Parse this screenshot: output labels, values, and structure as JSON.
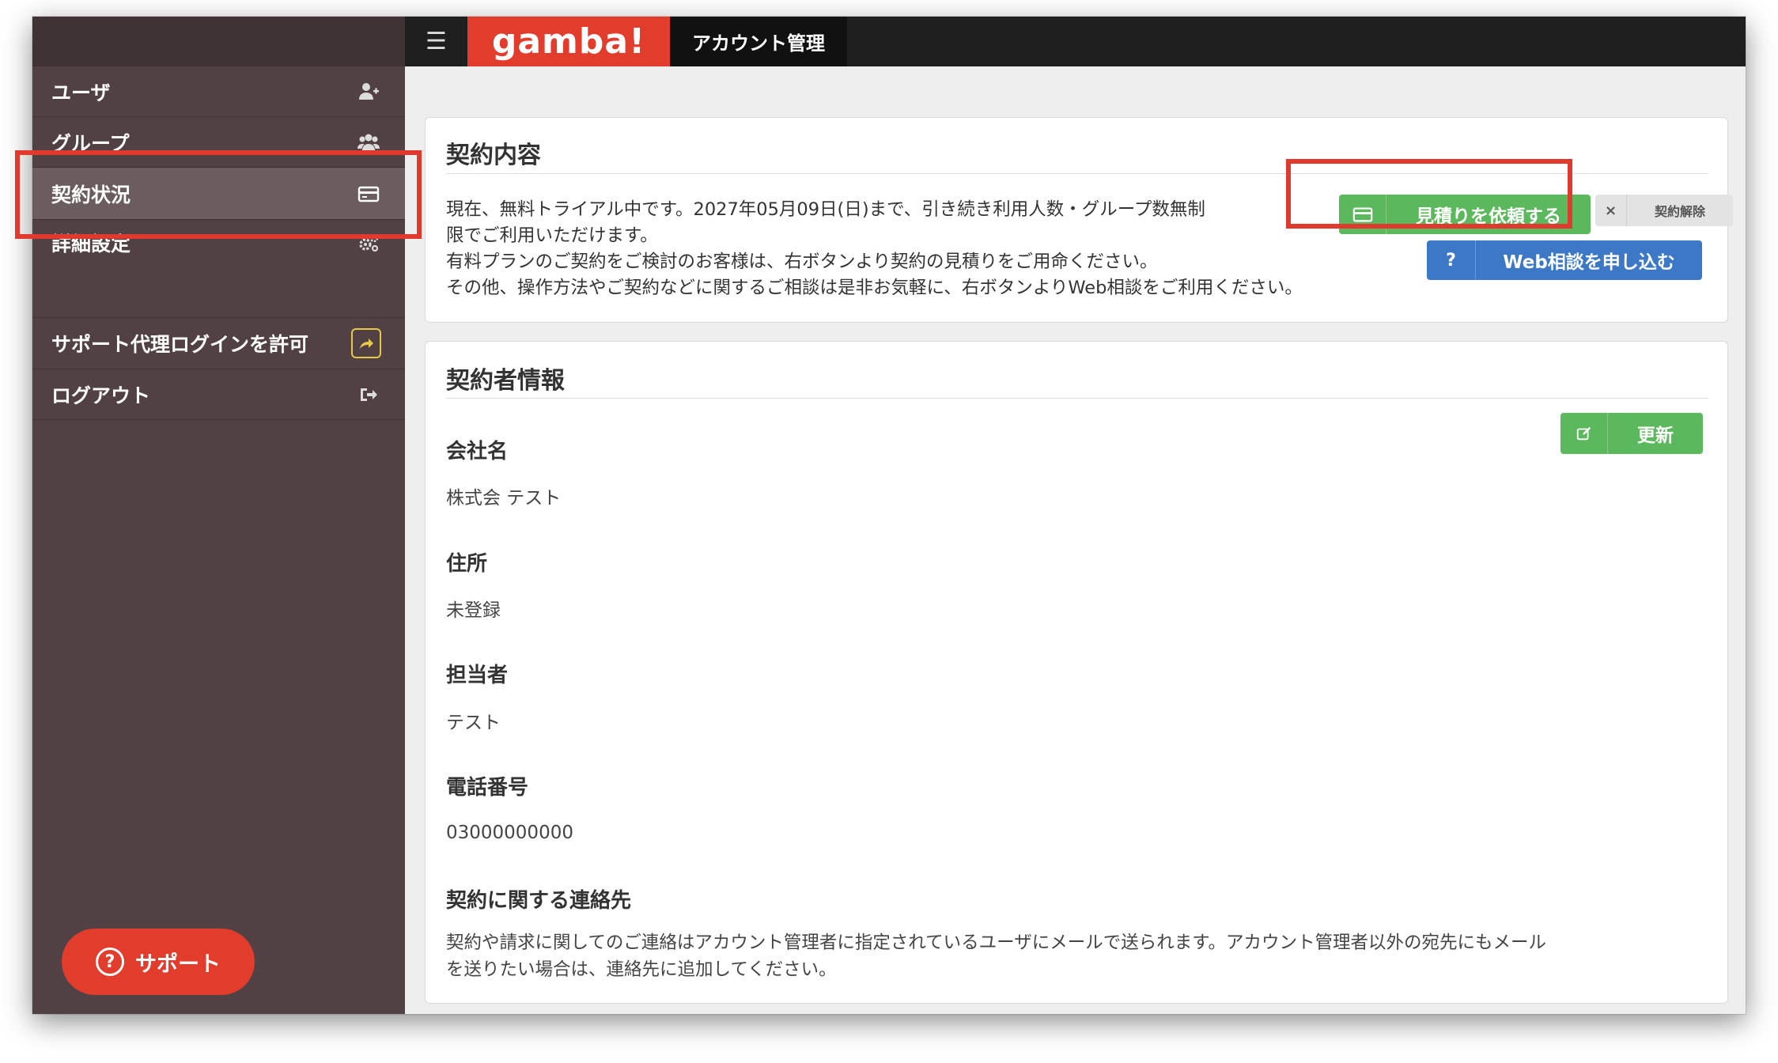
{
  "topbar": {
    "menu_icon": "hamburger-icon",
    "logo": "gamba!",
    "page_tab": "アカウント管理"
  },
  "sidebar": {
    "items": [
      {
        "label": "ユーザ",
        "icon": "user-plus-icon"
      },
      {
        "label": "グループ",
        "icon": "users-icon"
      },
      {
        "label": "契約状況",
        "icon": "credit-card-icon",
        "active": true
      },
      {
        "label": "詳細設定",
        "icon": "gears-icon"
      },
      {
        "label": "サポート代理ログインを許可",
        "icon": "share-icon"
      },
      {
        "label": "ログアウト",
        "icon": "logout-icon"
      }
    ],
    "support_button": "サポート"
  },
  "contract": {
    "title": "契約内容",
    "lines": [
      "現在、無料トライアル中です。2027年05月09日(日)まで、引き続き利用人数・グループ数無制",
      "限でご利用いただけます。",
      "有料プランのご契約をご検討のお客様は、右ボタンより契約の見積りをご用命ください。",
      "その他、操作方法やご契約などに関するご相談は是非お気軽に、右ボタンよりWeb相談をご利用ください。"
    ],
    "quote_button": "見積りを依頼する",
    "cancel_button": "契約解除",
    "cancel_icon": "×",
    "web_consult_button": "Web相談を申し込む",
    "web_consult_icon": "?"
  },
  "contractor": {
    "title": "契約者情報",
    "update_button": "更新",
    "fields": [
      {
        "label": "会社名",
        "value": "株式会 テスト"
      },
      {
        "label": "住所",
        "value": "未登録"
      },
      {
        "label": "担当者",
        "value": "テスト"
      },
      {
        "label": "電話番号",
        "value": "03000000000"
      }
    ],
    "contact_label": "契約に関する連絡先",
    "contact_lines": [
      "契約や請求に関してのご連絡はアカウント管理者に指定されているユーザにメールで送られます。アカウント管理者以外の宛先にもメール",
      "を送りたい場合は、連絡先に追加してください。"
    ]
  },
  "colors": {
    "sidebar_bg": "#514144",
    "accent_red": "#e23c2c",
    "green": "#5cb85c",
    "blue": "#3c78c6",
    "highlight": "#e03a2f"
  }
}
